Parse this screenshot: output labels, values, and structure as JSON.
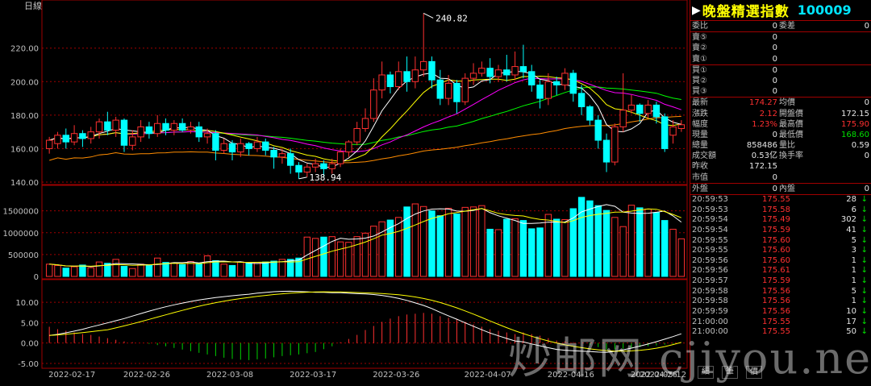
{
  "main_label": "日線",
  "price_panel": {
    "high_annotation": "240.82",
    "low_annotation": "138.94",
    "y_ticks": [
      "220.00",
      "200.00",
      "180.00",
      "160.00",
      "140.00"
    ]
  },
  "volume_panel": {
    "y_ticks": [
      "1500000",
      "1000000",
      "500000",
      "0"
    ]
  },
  "macd_panel": {
    "y_ticks": [
      "10.00",
      "5.00",
      "0.00",
      "-5.00"
    ]
  },
  "x_axis": [
    "2022-02-17",
    "2022-02-26",
    "2022-03-08",
    "2022-03-17",
    "2022-03-26",
    "2022-04-07",
    "2022-04-16",
    "2022-04-26",
    "2022-05-12"
  ],
  "colors": {
    "up": "#ff3030",
    "down": "#00ffff",
    "ma5": "#ffffff",
    "ma10": "#ffff00",
    "ma20": "#ff00ff",
    "ma30": "#00ff00",
    "ma60": "#ff8c00",
    "grid": "#a00000"
  },
  "chart_data": {
    "type": "candlestick",
    "ylim": [
      140,
      242
    ],
    "candles": [
      [
        160,
        165,
        157,
        167
      ],
      [
        163,
        168,
        160,
        170
      ],
      [
        168,
        164,
        160,
        172
      ],
      [
        164,
        169,
        162,
        174
      ],
      [
        169,
        166,
        161,
        171
      ],
      [
        166,
        170,
        163,
        173
      ],
      [
        170,
        176,
        166,
        178
      ],
      [
        176,
        171,
        168,
        182
      ],
      [
        171,
        177,
        167,
        179
      ],
      [
        177,
        162,
        158,
        178
      ],
      [
        162,
        167,
        159,
        171
      ],
      [
        167,
        173,
        164,
        177
      ],
      [
        173,
        169,
        166,
        176
      ],
      [
        169,
        175,
        167,
        180
      ],
      [
        175,
        171,
        168,
        178
      ],
      [
        171,
        175,
        168,
        177
      ],
      [
        175,
        171,
        170,
        178
      ],
      [
        171,
        173,
        169,
        176
      ],
      [
        173,
        167,
        164,
        176
      ],
      [
        167,
        169,
        163,
        172
      ],
      [
        169,
        159,
        153,
        171
      ],
      [
        159,
        163,
        157,
        166
      ],
      [
        163,
        158,
        153,
        165
      ],
      [
        158,
        163,
        155,
        166
      ],
      [
        163,
        160,
        156,
        164
      ],
      [
        160,
        164,
        158,
        167
      ],
      [
        164,
        159,
        156,
        166
      ],
      [
        159,
        155,
        148,
        161
      ],
      [
        155,
        157,
        151,
        160
      ],
      [
        157,
        150,
        145,
        160
      ],
      [
        150,
        146,
        142,
        152
      ],
      [
        146,
        149,
        143,
        151
      ],
      [
        149,
        151,
        146,
        154
      ],
      [
        151,
        148,
        143,
        153
      ],
      [
        148,
        151,
        145,
        154
      ],
      [
        151,
        158,
        149,
        160
      ],
      [
        158,
        164,
        155,
        165
      ],
      [
        164,
        172,
        162,
        176
      ],
      [
        172,
        178,
        170,
        184
      ],
      [
        178,
        195,
        176,
        202
      ],
      [
        195,
        204,
        190,
        212
      ],
      [
        204,
        197,
        193,
        206
      ],
      [
        197,
        206,
        195,
        212
      ],
      [
        206,
        200,
        194,
        215
      ],
      [
        200,
        207,
        196,
        215
      ],
      [
        207,
        212,
        203,
        240.82
      ],
      [
        212,
        201,
        196,
        215
      ],
      [
        201,
        190,
        186,
        207
      ],
      [
        190,
        199,
        186,
        204
      ],
      [
        199,
        188,
        181,
        201
      ],
      [
        188,
        202,
        186,
        205
      ],
      [
        202,
        205,
        198,
        211
      ],
      [
        205,
        208,
        203,
        212
      ],
      [
        208,
        203,
        199,
        214
      ],
      [
        203,
        207,
        200,
        210
      ],
      [
        207,
        204,
        200,
        216
      ],
      [
        204,
        209,
        201,
        218
      ],
      [
        209,
        206,
        202,
        222
      ],
      [
        206,
        198,
        194,
        210
      ],
      [
        198,
        190,
        184,
        201
      ],
      [
        190,
        200,
        186,
        205
      ],
      [
        200,
        198,
        192,
        203
      ],
      [
        198,
        205,
        195,
        208
      ],
      [
        205,
        193,
        188,
        207
      ],
      [
        193,
        185,
        180,
        198
      ],
      [
        185,
        177,
        174,
        186
      ],
      [
        177,
        165,
        160,
        180
      ],
      [
        165,
        152,
        146,
        169
      ],
      [
        152,
        173,
        150,
        175
      ],
      [
        173,
        183,
        170,
        205
      ],
      [
        183,
        186,
        181,
        192
      ],
      [
        186,
        181,
        176,
        187
      ],
      [
        181,
        186,
        178,
        189
      ],
      [
        186,
        179,
        175,
        188
      ],
      [
        179,
        160,
        158,
        181
      ],
      [
        168,
        173,
        163,
        177
      ],
      [
        172,
        174.27,
        170,
        177
      ]
    ],
    "volume": [
      280000,
      250000,
      190000,
      220000,
      260000,
      200000,
      330000,
      300000,
      390000,
      230000,
      180000,
      280000,
      250000,
      420000,
      320000,
      310000,
      270000,
      340000,
      300000,
      470000,
      360000,
      280000,
      250000,
      330000,
      300000,
      320000,
      330000,
      350000,
      390000,
      390000,
      420000,
      900000,
      870000,
      900000,
      910000,
      790000,
      780000,
      910000,
      990000,
      1150000,
      1250000,
      1290000,
      1350000,
      1590000,
      1660000,
      1600000,
      1500000,
      1390000,
      1560000,
      1430000,
      1580000,
      1590000,
      1620000,
      1080000,
      1070000,
      1310000,
      1320000,
      1280000,
      1090000,
      1110000,
      1420000,
      1310000,
      1300000,
      1550000,
      1810000,
      1730000,
      1620000,
      1510000,
      1350000,
      1140000,
      1630000,
      1570000,
      1540000,
      1460000,
      1280000,
      1080000,
      860000
    ],
    "macd_hist": [
      4,
      3.4,
      3,
      2.6,
      2.2,
      2,
      1.6,
      1.2,
      0.8,
      0.4,
      0.2,
      0,
      -0.2,
      -0.5,
      -0.8,
      -1.2,
      -1.6,
      -2,
      -2.4,
      -2.8,
      -3.2,
      -3.6,
      -3.9,
      -4.1,
      -4.2,
      -4,
      -3.8,
      -3.5,
      -3.2,
      -3,
      -2.8,
      -2.5,
      -2.2,
      -1.5,
      -0.8,
      0.2,
      1,
      2,
      3.2,
      4.2,
      5.2,
      6,
      6.6,
      7,
      7.2,
      7.4,
      7.2,
      6.6,
      6.2,
      5.8,
      5.2,
      4.6,
      4,
      3.4,
      3,
      2.6,
      2.2,
      2.6,
      2.2,
      1.8,
      1.2,
      0.6,
      0.4,
      0.2,
      0,
      -0.4,
      -1,
      -1.6,
      -1.6,
      -1.4,
      -1.2,
      -1,
      -0.8,
      -0.6,
      -0.4,
      -0.2,
      0
    ]
  },
  "quote": {
    "title_mark": "▶",
    "name": "晚盤精選指數",
    "code": "100009",
    "weibi_label": "委比",
    "weibi_value": "0",
    "weicha_label": "委差",
    "weicha_value": "0",
    "sell": [
      {
        "label": "賣⑤",
        "value": "0"
      },
      {
        "label": "賣②",
        "value": "0"
      },
      {
        "label": "賣①",
        "value": "0"
      }
    ],
    "buy": [
      {
        "label": "買①",
        "value": "0"
      },
      {
        "label": "買②",
        "value": "0"
      },
      {
        "label": "買③",
        "value": "0"
      }
    ],
    "latest_label": "最新",
    "latest": "174.27",
    "avg_label": "均價",
    "avg": "0",
    "change_label": "漲跌",
    "change": "2.12",
    "open_label": "開盤價",
    "open": "172.15",
    "pct_label": "幅度",
    "pct": "1.23%",
    "high_label": "最高價",
    "high": "175.90",
    "nowvol_label": "現量",
    "nowvol": "0",
    "low_label": "最低價",
    "low": "168.60",
    "totalvol_label": "總量",
    "totalvol": "858486",
    "ratio_label": "量比",
    "ratio": "0.59",
    "amount_label": "成交額",
    "amount": "0.53亿",
    "turnover_label": "換手率",
    "turnover": "0",
    "prevclose_label": "昨收",
    "prevclose": "172.15",
    "mktval_label": "市值",
    "mktval": "0",
    "outer_label": "外盤",
    "outer": "0",
    "inner_label": "內盤",
    "inner": "0"
  },
  "ticks": [
    {
      "time": "20:59:53",
      "price": "175.55",
      "vol": "28"
    },
    {
      "time": "20:59:53",
      "price": "175.58",
      "vol": "6"
    },
    {
      "time": "20:59:54",
      "price": "175.49",
      "vol": "302"
    },
    {
      "time": "20:59:54",
      "price": "175.59",
      "vol": "41"
    },
    {
      "time": "20:59:55",
      "price": "175.60",
      "vol": "5"
    },
    {
      "time": "20:59:55",
      "price": "175.60",
      "vol": "3"
    },
    {
      "time": "20:59:56",
      "price": "175.60",
      "vol": "1"
    },
    {
      "time": "20:59:56",
      "price": "175.61",
      "vol": "1"
    },
    {
      "time": "20:59:57",
      "price": "175.59",
      "vol": "1"
    },
    {
      "time": "20:59:58",
      "price": "175.56",
      "vol": "5"
    },
    {
      "time": "20:59:58",
      "price": "175.56",
      "vol": "1"
    },
    {
      "time": "20:59:59",
      "price": "175.56",
      "vol": "10"
    },
    {
      "time": "21:00:00",
      "price": "175.55",
      "vol": "17"
    },
    {
      "time": "21:00:00",
      "price": "175.55",
      "vol": "50"
    }
  ],
  "tick_arrow": "↓",
  "tabs": [
    "細",
    "筆",
    "價"
  ],
  "watermark": "炒邮网 cjiyou.net"
}
